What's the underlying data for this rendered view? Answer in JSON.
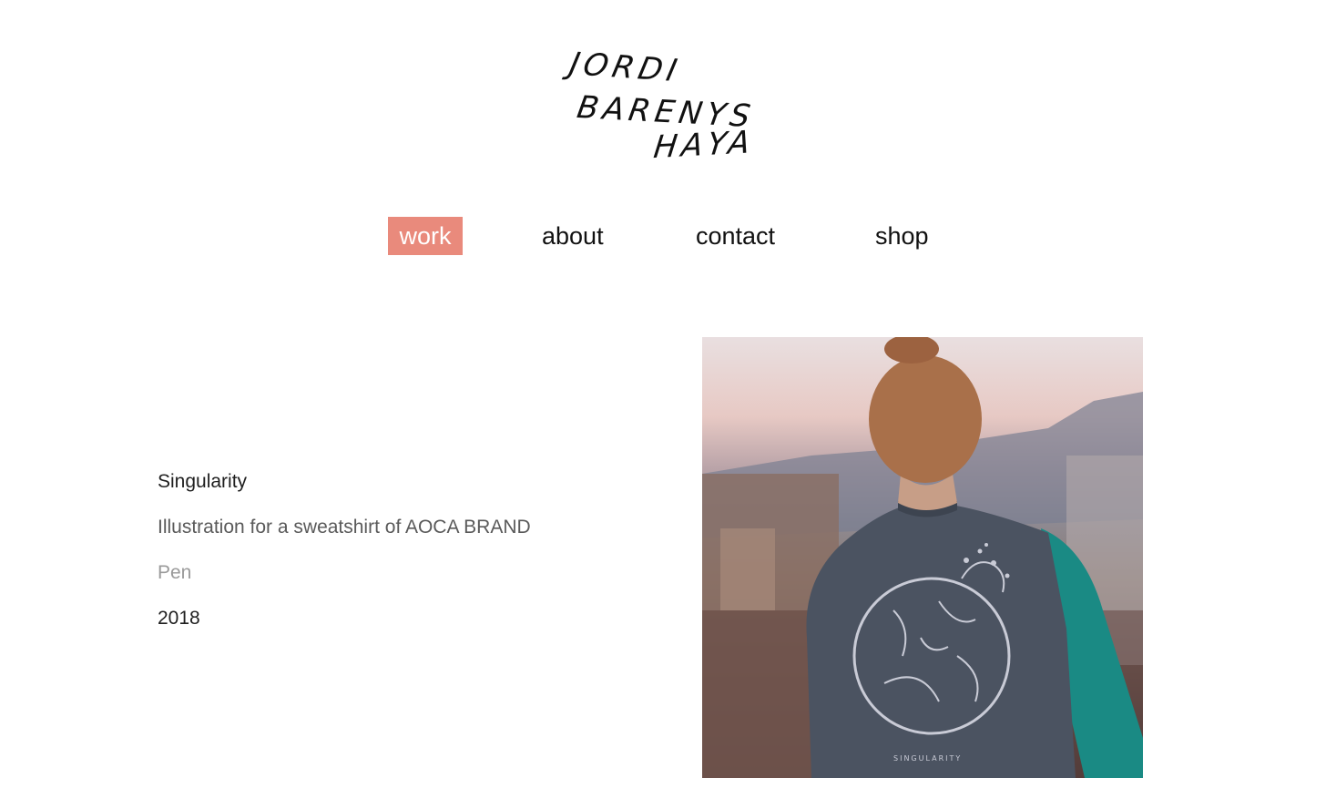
{
  "logo": {
    "line1": "JORDI",
    "line2": "BARENYS",
    "line3": "HAYA"
  },
  "nav": {
    "items": [
      {
        "label": "work",
        "active": true
      },
      {
        "label": "about",
        "active": false
      },
      {
        "label": "contact",
        "active": false
      },
      {
        "label": "shop",
        "active": false
      }
    ]
  },
  "project": {
    "title": "Singularity",
    "description": "Illustration for a sweatshirt of AOCA BRAND",
    "medium": "Pen",
    "year": "2018"
  },
  "photo": {
    "print_text": "SINGULARITY"
  },
  "colors": {
    "accent": "#e98a7c",
    "text": "#1a1a1a",
    "muted": "#5a5a5a",
    "light": "#9a9a9a"
  }
}
